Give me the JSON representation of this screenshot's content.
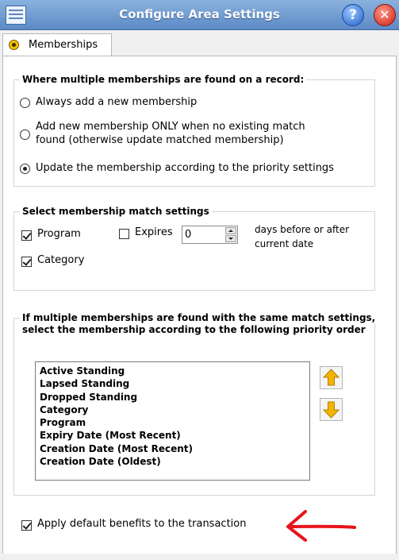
{
  "window": {
    "title": "Configure Area Settings",
    "help_label": "?",
    "close_label": "✕"
  },
  "tabs": [
    {
      "label": "Memberships",
      "icon": "membership-badge-icon"
    }
  ],
  "multiple_memberships": {
    "title": "Where multiple memberships are found on a record:",
    "options": [
      {
        "label": "Always add a new membership",
        "selected": false
      },
      {
        "label_line1": "Add new membership ONLY when no existing match",
        "label_line2": "found (otherwise update matched membership)",
        "selected": false
      },
      {
        "label": "Update the membership according to the priority settings",
        "selected": true
      }
    ]
  },
  "match_settings": {
    "title": "Select membership match settings",
    "program": {
      "label": "Program",
      "checked": true
    },
    "category": {
      "label": "Category",
      "checked": true
    },
    "expires": {
      "label": "Expires",
      "checked": false,
      "value": "0"
    },
    "days_note_line1": "days before or after",
    "days_note_line2": "current date"
  },
  "priority": {
    "title_line1": "If multiple memberships are found with the same match settings,",
    "title_line2": "select the membership according to the following priority order",
    "items": [
      "Active Standing",
      "Lapsed Standing",
      "Dropped Standing",
      "Category",
      "Program",
      "Expiry Date (Most Recent)",
      "Creation Date (Most Recent)",
      "Creation Date (Oldest)"
    ]
  },
  "apply_benefits": {
    "label": "Apply default benefits to the transaction",
    "checked": true
  },
  "colors": {
    "title_bar": "#6b97d0",
    "annotation_arrow": "#e8141b",
    "move_arrow": "#f2b400"
  }
}
